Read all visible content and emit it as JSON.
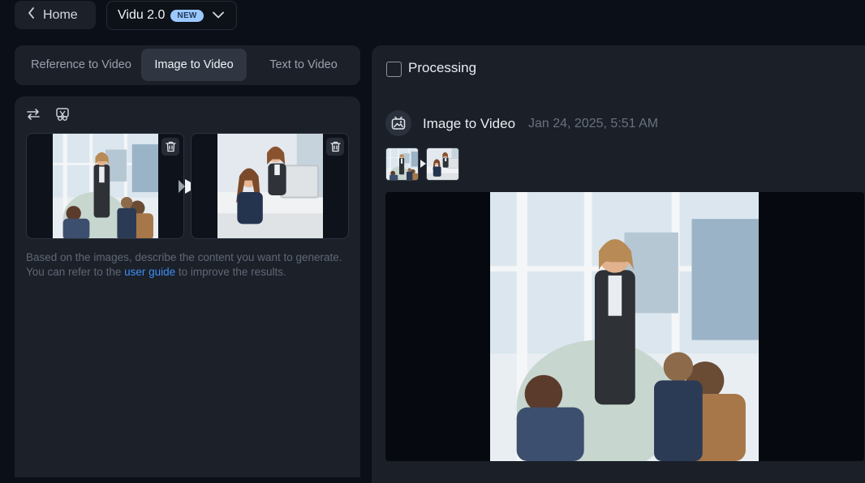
{
  "topbar": {
    "home_label": "Home",
    "model_name": "Vidu 2.0",
    "model_badge": "NEW"
  },
  "mode_tabs": [
    {
      "label": "Reference to Video",
      "active": false
    },
    {
      "label": "Image to Video",
      "active": true
    },
    {
      "label": "Text to Video",
      "active": false
    }
  ],
  "input_panel": {
    "description_before": "Based on the images, describe the content you want to generate. You can refer to the ",
    "description_link": "user guide",
    "description_after": " to improve the results."
  },
  "output_panel": {
    "processing_label": "Processing",
    "task": {
      "title": "Image to Video",
      "timestamp": "Jan 24, 2025, 5:51 AM"
    }
  },
  "colors": {
    "background": "#0b1018",
    "panel": "#1b2029",
    "active_tab": "#2f3642",
    "accent_link": "#3f8ef6",
    "badge": "#9cc8ff"
  },
  "icons": [
    "chevron-left-icon",
    "chevron-down-icon",
    "swap-icon",
    "crop-icon",
    "trash-icon",
    "play-icon",
    "image-video-icon"
  ]
}
